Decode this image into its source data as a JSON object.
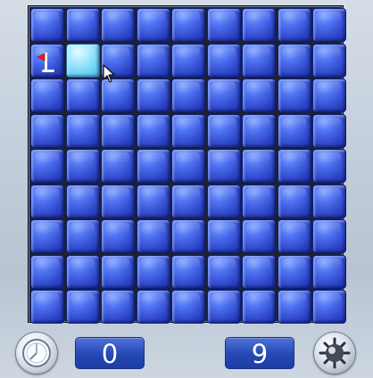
{
  "board": {
    "rows": 9,
    "cols": 9,
    "flagged_cell": {
      "row": 2,
      "col": 1
    },
    "hover_cell": {
      "row": 2,
      "col": 2
    }
  },
  "hud": {
    "time_value": "0",
    "mines_remaining": "9",
    "timer_icon": "stopwatch-icon",
    "mine_icon": "mine-icon"
  },
  "colors": {
    "tile": "#2d46c8",
    "tile_highlight": "#a8ecff",
    "counter_bg": "#2547b4",
    "flag": "#e11b1b"
  }
}
